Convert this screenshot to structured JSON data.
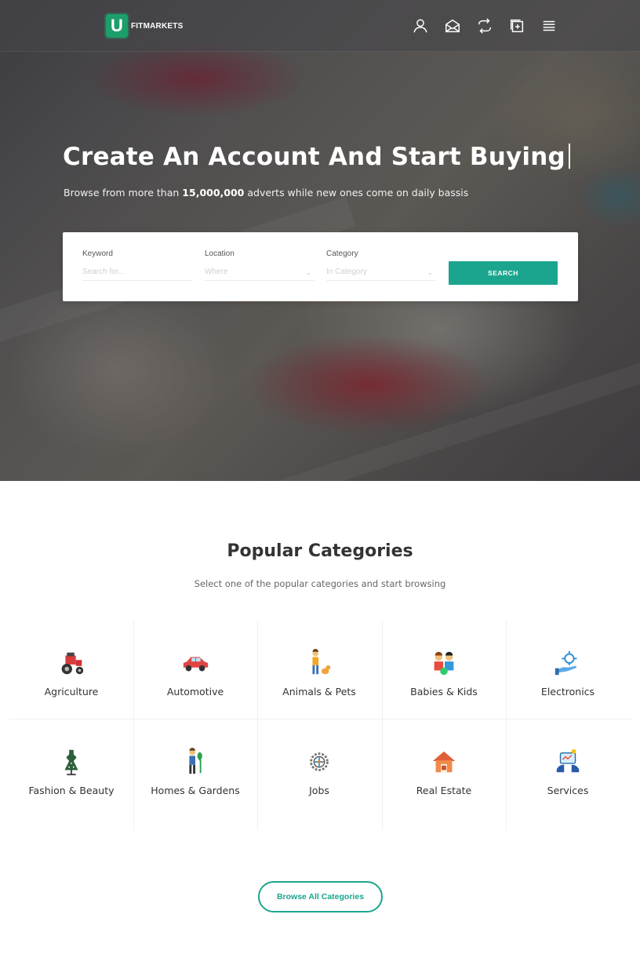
{
  "header": {
    "logo_letter": "U",
    "logo_text": "FITMARKETS",
    "icons": [
      "user-icon",
      "envelope-icon",
      "refresh-icon",
      "add-listing-icon",
      "menu-icon"
    ]
  },
  "hero": {
    "title": "Create An Account And Start Buying",
    "subtitle_prefix": "Browse from more than ",
    "subtitle_count": "15,000,000",
    "subtitle_suffix": " adverts while new ones come on daily bassis"
  },
  "search": {
    "keyword_label": "Keyword",
    "keyword_placeholder": "Search for...",
    "location_label": "Location",
    "location_placeholder": "Where",
    "category_label": "Category",
    "category_placeholder": "In Category",
    "button": "SEARCH"
  },
  "categories": {
    "title": "Popular Categories",
    "subtitle": "Select one of the popular categories and start browsing",
    "items": [
      {
        "label": "Agriculture",
        "icon": "tractor-icon"
      },
      {
        "label": "Automotive",
        "icon": "car-icon"
      },
      {
        "label": "Animals & Pets",
        "icon": "pet-owner-icon"
      },
      {
        "label": "Babies & Kids",
        "icon": "kids-icon"
      },
      {
        "label": "Electronics",
        "icon": "electronics-hand-icon"
      },
      {
        "label": "Fashion & Beauty",
        "icon": "dress-mannequin-icon"
      },
      {
        "label": "Homes & Gardens",
        "icon": "gardener-icon"
      },
      {
        "label": "Jobs",
        "icon": "gear-badge-icon"
      },
      {
        "label": "Real Estate",
        "icon": "house-icon"
      },
      {
        "label": "Services",
        "icon": "services-icon"
      }
    ],
    "browse_button": "Browse All Categories"
  },
  "colors": {
    "accent": "#1ba58e",
    "logo": "#1e9e6b"
  }
}
